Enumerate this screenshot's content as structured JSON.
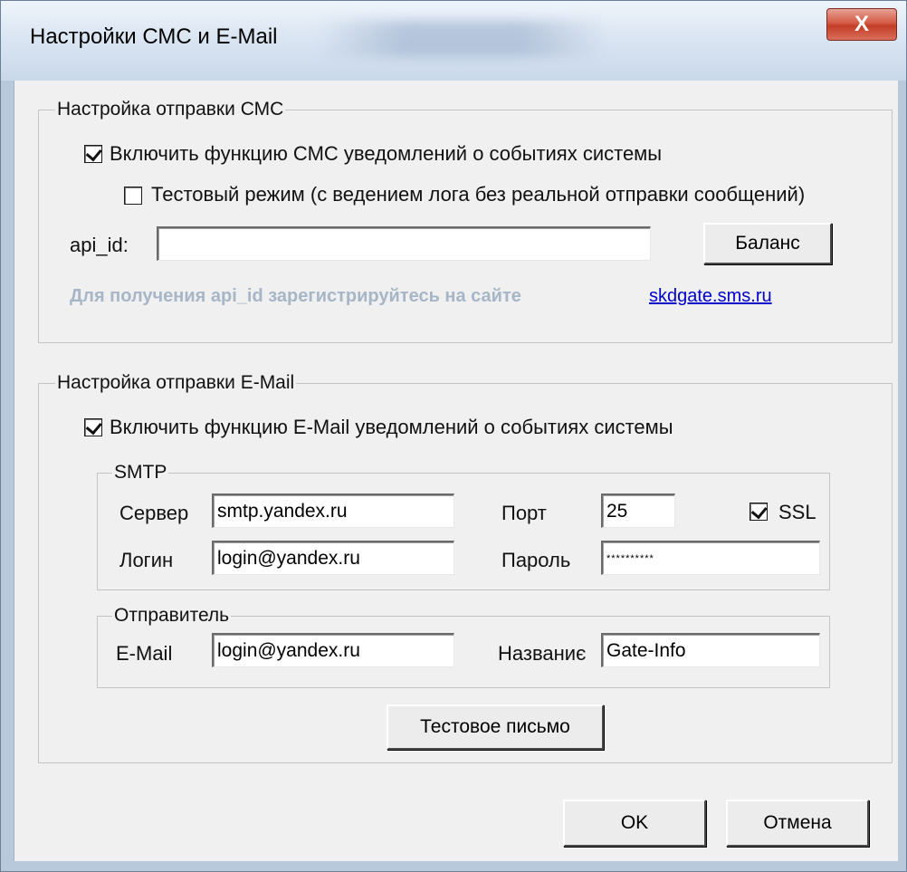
{
  "window": {
    "title": "Настройки СМС и E-Mail",
    "close_label": "X"
  },
  "sms": {
    "group_title": "Настройка отправки СМС",
    "enable_label": "Включить функцию СМС уведомлений о событиях системы",
    "enable_checked": true,
    "test_label": "Тестовый режим (с ведением лога без реальной отправки сообщений)",
    "test_checked": false,
    "api_id_label": "api_id:",
    "api_id_value": "",
    "balance_button": "Баланс",
    "hint": "Для получения api_id зарегистрируйтесь на сайте",
    "link": "skdgate.sms.ru"
  },
  "email": {
    "group_title": "Настройка отправки E-Mail",
    "enable_label": "Включить функцию E-Mail уведомлений о событиях системы",
    "enable_checked": true,
    "smtp": {
      "group_title": "SMTP",
      "server_label": "Сервер",
      "server_value": "smtp.yandex.ru",
      "port_label": "Порт",
      "port_value": "25",
      "ssl_label": "SSL",
      "ssl_checked": true,
      "login_label": "Логин",
      "login_value": "login@yandex.ru",
      "password_label": "Пароль",
      "password_value": "**********"
    },
    "sender": {
      "group_title": "Отправитель",
      "email_label": "E-Mail",
      "email_value": "login@yandex.ru",
      "name_label": "Названиє",
      "name_value": "Gate-Info"
    },
    "test_button": "Тестовое письмо"
  },
  "footer": {
    "ok_button": "OK",
    "cancel_button": "Отмена"
  },
  "colors": {
    "hint": "#a7b6c7",
    "link": "#0000cc",
    "close": "#c43c25"
  }
}
